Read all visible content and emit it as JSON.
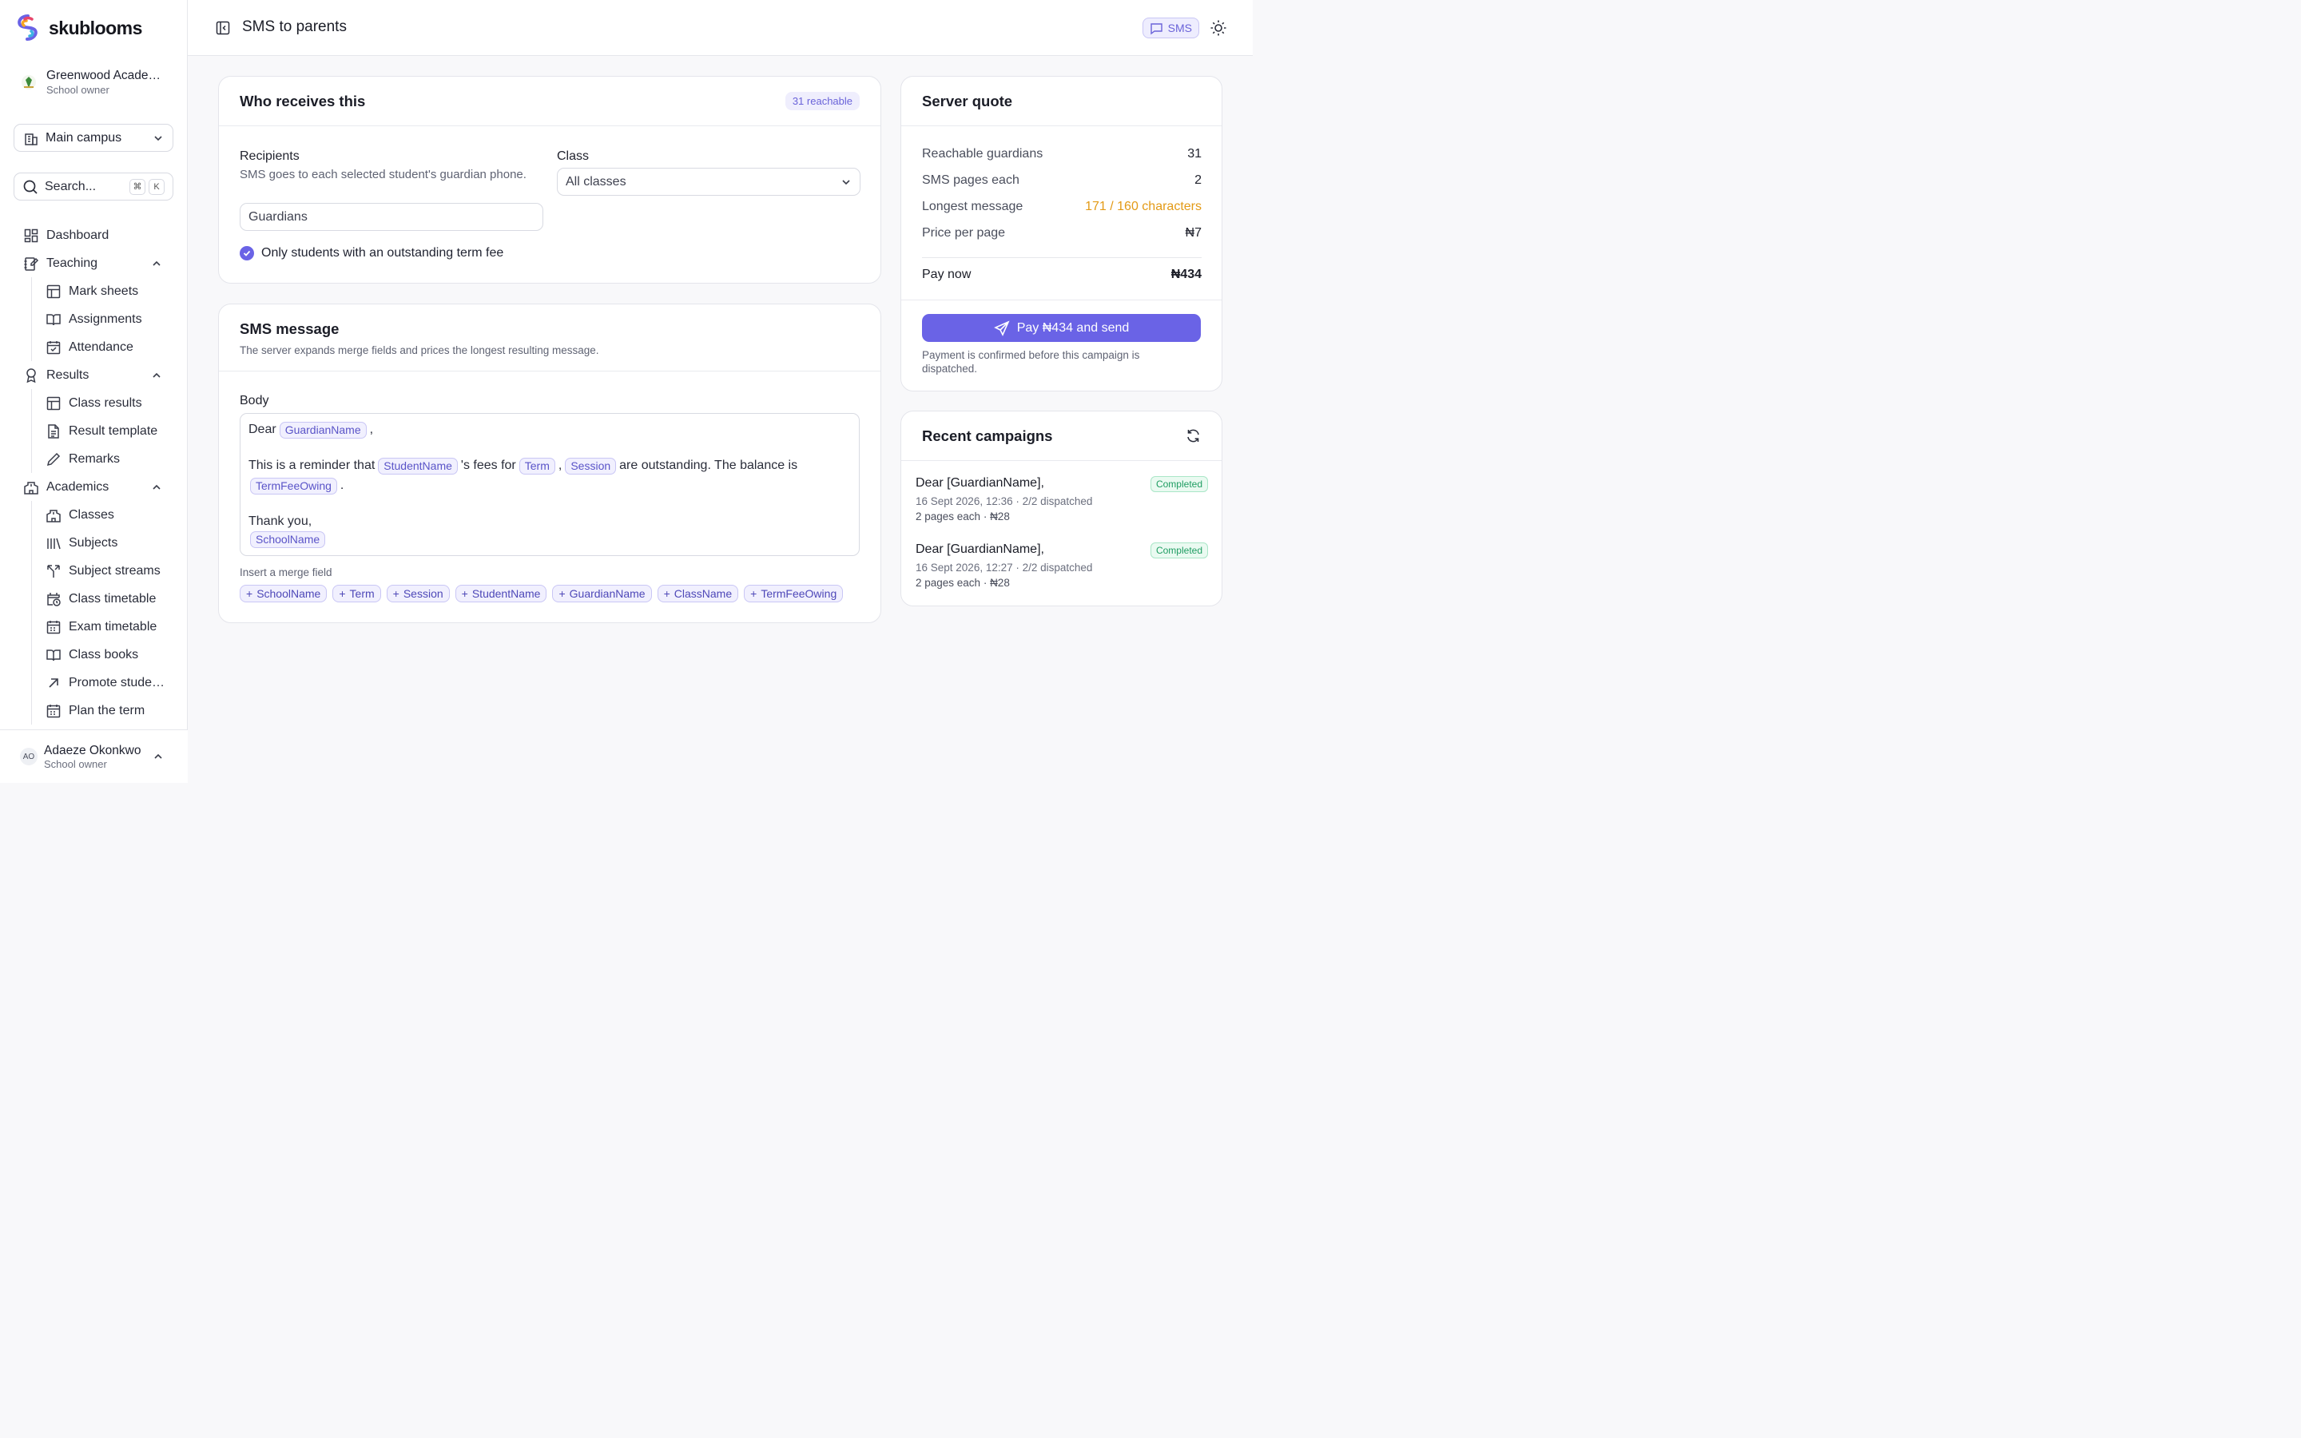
{
  "brand": {
    "name": "skublooms"
  },
  "school": {
    "name": "Greenwood Acade…",
    "role": "School owner"
  },
  "campus": {
    "label": "Main campus"
  },
  "search": {
    "placeholder": "Search...",
    "kbd1": "⌘",
    "kbd2": "K"
  },
  "nav": {
    "dashboard": "Dashboard",
    "teaching": "Teaching",
    "mark_sheets": "Mark sheets",
    "assignments": "Assignments",
    "attendance": "Attendance",
    "results": "Results",
    "class_results": "Class results",
    "result_template": "Result template",
    "remarks": "Remarks",
    "academics": "Academics",
    "classes": "Classes",
    "subjects": "Subjects",
    "subject_streams": "Subject streams",
    "class_timetable": "Class timetable",
    "exam_timetable": "Exam timetable",
    "class_books": "Class books",
    "promote_students": "Promote stude…",
    "plan_term": "Plan the term"
  },
  "user": {
    "initials": "AO",
    "name": "Adaeze Okonkwo",
    "role": "School owner"
  },
  "header": {
    "title": "SMS to parents",
    "chip": "SMS"
  },
  "who": {
    "title": "Who receives this",
    "reachable_badge": "31 reachable",
    "recipients_label": "Recipients",
    "recipients_help": "SMS goes to each selected student's guardian phone.",
    "recipients_value": "Guardians",
    "class_label": "Class",
    "class_value": "All classes",
    "outstanding_label": "Only students with an outstanding term fee",
    "outstanding_checked": true
  },
  "message": {
    "title": "SMS message",
    "subtitle": "The server expands merge fields and prices the longest resulting message.",
    "body_label": "Body",
    "body": {
      "dear": "Dear",
      "comma": ",",
      "reminder": "This is a reminder that",
      "fees_for": "'s fees for",
      "sep": ",",
      "outstanding": "are outstanding. The balance is",
      "period": ".",
      "thanks": "Thank you,",
      "tok_guardian": "GuardianName",
      "tok_student": "StudentName",
      "tok_term": "Term",
      "tok_session": "Session",
      "tok_fee": "TermFeeOwing",
      "tok_school": "SchoolName"
    },
    "insert_label": "Insert a merge field",
    "merge_fields": [
      "SchoolName",
      "Term",
      "Session",
      "StudentName",
      "GuardianName",
      "ClassName",
      "TermFeeOwing"
    ]
  },
  "quote": {
    "title": "Server quote",
    "rows": [
      {
        "label": "Reachable guardians",
        "value": "31"
      },
      {
        "label": "SMS pages each",
        "value": "2"
      },
      {
        "label": "Longest message",
        "value": "171 / 160 characters"
      },
      {
        "label": "Price per page",
        "value": "₦7"
      }
    ],
    "total_label": "Pay now",
    "total_value": "₦434",
    "pay_button": "Pay ₦434 and send",
    "note": "Payment is confirmed before this campaign is dispatched.",
    "warn_color": "#e39a16"
  },
  "recent": {
    "title": "Recent campaigns",
    "items": [
      {
        "title": "Dear [GuardianName],",
        "meta": "16 Sept 2026, 12:36 · 2/2 dispatched",
        "detail": "2 pages each · ₦28",
        "status": "Completed"
      },
      {
        "title": "Dear [GuardianName],",
        "meta": "16 Sept 2026, 12:27 · 2/2 dispatched",
        "detail": "2 pages each · ₦28",
        "status": "Completed"
      }
    ]
  },
  "colors": {
    "accent": "#6a63e6",
    "success": "#1f9d62"
  }
}
